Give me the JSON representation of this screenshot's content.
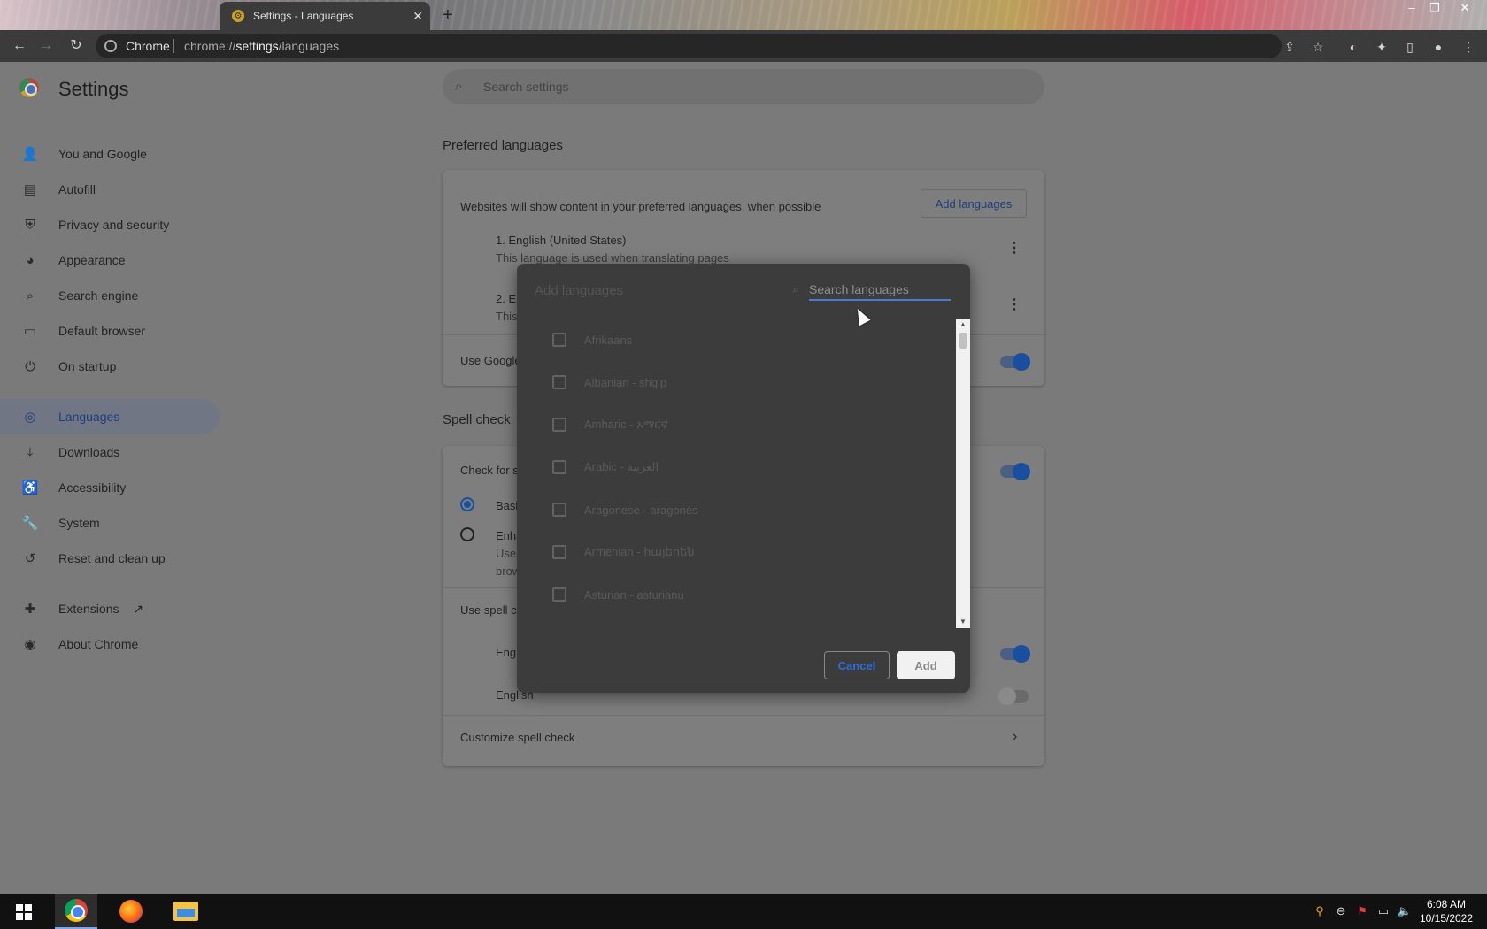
{
  "browser": {
    "tab_title": "Settings - Languages",
    "tab_close": "✕",
    "new_tab": "+",
    "omnibox_site": "Chrome",
    "url_prefix": "chrome://",
    "url_bold": "settings",
    "url_suffix": "/languages"
  },
  "settings": {
    "title": "Settings",
    "search_placeholder": "Search settings",
    "sidebar": [
      {
        "label": "You and Google",
        "icon": "person-icon"
      },
      {
        "label": "Autofill",
        "icon": "clipboard-icon"
      },
      {
        "label": "Privacy and security",
        "icon": "shield-icon"
      },
      {
        "label": "Appearance",
        "icon": "palette-icon"
      },
      {
        "label": "Search engine",
        "icon": "search-icon"
      },
      {
        "label": "Default browser",
        "icon": "browser-icon"
      },
      {
        "label": "On startup",
        "icon": "power-icon"
      },
      {
        "label": "Languages",
        "icon": "globe-icon",
        "active": true
      },
      {
        "label": "Downloads",
        "icon": "download-icon"
      },
      {
        "label": "Accessibility",
        "icon": "accessibility-icon"
      },
      {
        "label": "System",
        "icon": "wrench-icon"
      },
      {
        "label": "Reset and clean up",
        "icon": "history-icon"
      },
      {
        "label": "Extensions",
        "icon": "puzzle-icon"
      },
      {
        "label": "About Chrome",
        "icon": "chrome-icon"
      }
    ],
    "preferred_languages": {
      "heading": "Preferred languages",
      "description": "Websites will show content in your preferred languages, when possible",
      "add_button": "Add languages",
      "lang1_name": "1. English (United States)",
      "lang1_sub": "This language is used when translating pages",
      "lang2_name": "2. En",
      "lang2_sub": "This",
      "use_google": "Use Google"
    },
    "spell_check": {
      "heading": "Spell check",
      "check_for": "Check for s",
      "basic": "Basi",
      "enhanced": "Enha",
      "enhanced_sub1": "Uses",
      "enhanced_sub2": "brow",
      "use_spell": "Use spell c",
      "english1": "Engl",
      "english2": "English",
      "customize": "Customize spell check",
      "customize_arrow": "›"
    }
  },
  "dialog": {
    "title": "Add languages",
    "search_placeholder": "Search languages",
    "languages": [
      "Afrikaans",
      "Albanian - shqip",
      "Amharic - አማርኛ",
      "Arabic - العربية",
      "Aragonese - aragonés",
      "Armenian - հայերեն",
      "Asturian - asturianu"
    ],
    "cancel_label": "Cancel",
    "add_label": "Add"
  },
  "taskbar": {
    "time": "6:08 AM",
    "date": "10/15/2022"
  }
}
